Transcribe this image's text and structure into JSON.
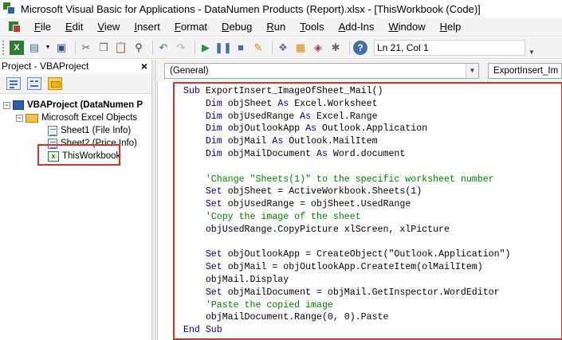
{
  "window": {
    "title": "Microsoft Visual Basic for Applications - DataNumen Products (Report).xlsx - [ThisWorkbook (Code)]"
  },
  "menu": {
    "items": [
      {
        "label": "File",
        "name": "menu-file"
      },
      {
        "label": "Edit",
        "name": "menu-edit"
      },
      {
        "label": "View",
        "name": "menu-view"
      },
      {
        "label": "Insert",
        "name": "menu-insert"
      },
      {
        "label": "Format",
        "name": "menu-format"
      },
      {
        "label": "Debug",
        "name": "menu-debug"
      },
      {
        "label": "Run",
        "name": "menu-run"
      },
      {
        "label": "Tools",
        "name": "menu-tools"
      },
      {
        "label": "Add-Ins",
        "name": "menu-add-ins"
      },
      {
        "label": "Window",
        "name": "menu-window"
      },
      {
        "label": "Help",
        "name": "menu-help"
      }
    ]
  },
  "toolbar": {
    "position": "Ln 21, Col 1",
    "icons": [
      "view-excel-icon",
      "insert-module-icon",
      "save-icon",
      "cut-icon",
      "copy-icon",
      "paste-icon",
      "find-icon",
      "undo-icon",
      "redo-icon",
      "run-icon",
      "break-icon",
      "reset-icon",
      "design-mode-icon",
      "project-explorer-icon",
      "properties-icon",
      "object-browser-icon",
      "toolbox-icon",
      "help-icon"
    ]
  },
  "project_pane": {
    "title": "Project - VBAProject",
    "close": "×",
    "tree": {
      "root": "VBAProject (DataNumen P",
      "folder": "Microsoft Excel Objects",
      "items": [
        "Sheet1 (File Info)",
        "Sheet2 (Price Info)",
        "ThisWorkbook"
      ]
    }
  },
  "code_pane": {
    "object_combo": "(General)",
    "procedure_combo": "ExportInsert_Im",
    "lines": [
      {
        "indent": "",
        "parts": [
          {
            "t": "Sub ",
            "c": "kw"
          },
          {
            "t": "ExportInsert_ImageOfSheet_Mail()",
            "c": ""
          }
        ]
      },
      {
        "indent": "    ",
        "parts": [
          {
            "t": "Dim ",
            "c": "kw"
          },
          {
            "t": "objSheet ",
            "c": ""
          },
          {
            "t": "As ",
            "c": "kw"
          },
          {
            "t": "Excel.Worksheet",
            "c": ""
          }
        ]
      },
      {
        "indent": "    ",
        "parts": [
          {
            "t": "Dim ",
            "c": "kw"
          },
          {
            "t": "objUsedRange ",
            "c": ""
          },
          {
            "t": "As ",
            "c": "kw"
          },
          {
            "t": "Excel.Range",
            "c": ""
          }
        ]
      },
      {
        "indent": "    ",
        "parts": [
          {
            "t": "Dim ",
            "c": "kw"
          },
          {
            "t": "objOutlookApp ",
            "c": ""
          },
          {
            "t": "As ",
            "c": "kw"
          },
          {
            "t": "Outlook.Application",
            "c": ""
          }
        ]
      },
      {
        "indent": "    ",
        "parts": [
          {
            "t": "Dim ",
            "c": "kw"
          },
          {
            "t": "objMail ",
            "c": ""
          },
          {
            "t": "As ",
            "c": "kw"
          },
          {
            "t": "Outlook.MailItem",
            "c": ""
          }
        ]
      },
      {
        "indent": "    ",
        "parts": [
          {
            "t": "Dim ",
            "c": "kw"
          },
          {
            "t": "objMailDocument ",
            "c": ""
          },
          {
            "t": "As ",
            "c": "kw"
          },
          {
            "t": "Word.document",
            "c": ""
          }
        ]
      },
      {
        "indent": "",
        "parts": []
      },
      {
        "indent": "    ",
        "parts": [
          {
            "t": "'Change \"Sheets(1)\" to the specific worksheet number",
            "c": "cm"
          }
        ]
      },
      {
        "indent": "    ",
        "parts": [
          {
            "t": "Set ",
            "c": "kw"
          },
          {
            "t": "objSheet = ActiveWorkbook.Sheets(1)",
            "c": ""
          }
        ]
      },
      {
        "indent": "    ",
        "parts": [
          {
            "t": "Set ",
            "c": "kw"
          },
          {
            "t": "objUsedRange = objSheet.UsedRange",
            "c": ""
          }
        ]
      },
      {
        "indent": "    ",
        "parts": [
          {
            "t": "'Copy the image of the sheet",
            "c": "cm"
          }
        ]
      },
      {
        "indent": "    ",
        "parts": [
          {
            "t": "objUsedRange.CopyPicture xlScreen, xlPicture",
            "c": ""
          }
        ]
      },
      {
        "indent": "",
        "parts": []
      },
      {
        "indent": "    ",
        "parts": [
          {
            "t": "Set ",
            "c": "kw"
          },
          {
            "t": "objOutlookApp = CreateObject(\"Outlook.Application\")",
            "c": ""
          }
        ]
      },
      {
        "indent": "    ",
        "parts": [
          {
            "t": "Set ",
            "c": "kw"
          },
          {
            "t": "objMail = objOutlookApp.CreateItem(olMailItem)",
            "c": ""
          }
        ]
      },
      {
        "indent": "    ",
        "parts": [
          {
            "t": "objMail.Display",
            "c": ""
          }
        ]
      },
      {
        "indent": "    ",
        "parts": [
          {
            "t": "Set ",
            "c": "kw"
          },
          {
            "t": "objMailDocument = objMail.GetInspector.WordEditor",
            "c": ""
          }
        ]
      },
      {
        "indent": "    ",
        "parts": [
          {
            "t": "'Paste the copied image",
            "c": "cm"
          }
        ]
      },
      {
        "indent": "    ",
        "parts": [
          {
            "t": "objMailDocument.Range(0, 0).Paste",
            "c": ""
          }
        ]
      },
      {
        "indent": "",
        "parts": [
          {
            "t": "End Sub",
            "c": "kw"
          }
        ]
      }
    ]
  },
  "colors": {
    "highlight_border": "#d9322b",
    "keyword": "#00008b",
    "comment": "#008000"
  }
}
